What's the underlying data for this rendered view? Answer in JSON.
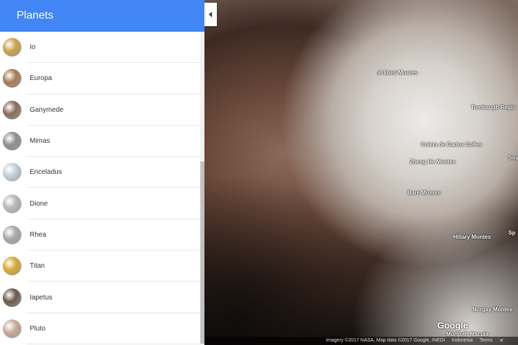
{
  "sidebar": {
    "title": "Planets",
    "items": [
      {
        "label": "Io",
        "color": "#c9a24a"
      },
      {
        "label": "Europa",
        "color": "#a57c52"
      },
      {
        "label": "Ganymede",
        "color": "#8a6d5a"
      },
      {
        "label": "Mimas",
        "color": "#8e8e8e"
      },
      {
        "label": "Enceladus",
        "color": "#c7d0d8"
      },
      {
        "label": "Dione",
        "color": "#b8b8b8"
      },
      {
        "label": "Rhea",
        "color": "#a8a8a8"
      },
      {
        "label": "Titan",
        "color": "#d9a835"
      },
      {
        "label": "Iapetus",
        "color": "#6b5a4a"
      },
      {
        "label": "Pluto",
        "color": "#c9a89a"
      }
    ]
  },
  "map": {
    "labels": [
      "al-Idrisi Montes",
      "Tombaugh Regio",
      "Coleta de Dados Colles",
      "Zheng He Montes",
      "Baré Montes",
      "Hillary Montes",
      "Norgay Montes",
      "Morgoth Macula",
      "Soy",
      "Sp"
    ],
    "google_logo": "Google",
    "attribution": "Imagery ©2017 NASA, Map data ©2017 Google, INEGI",
    "language": "Indonesia",
    "terms": "Terms",
    "extra": "w"
  }
}
